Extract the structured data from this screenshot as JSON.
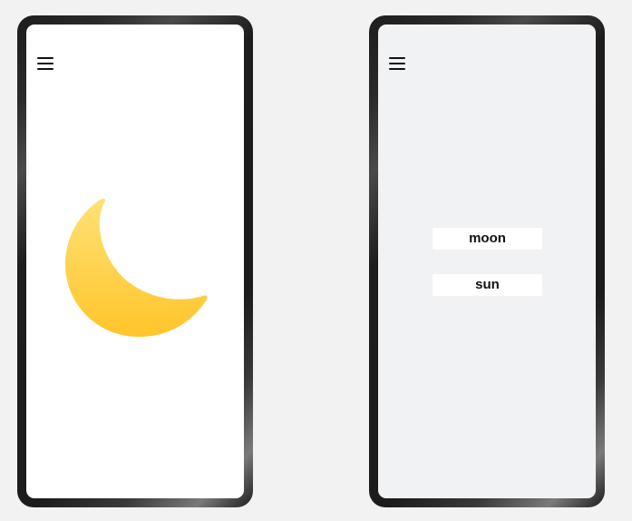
{
  "left_phone": {
    "menu_icon": "hamburger-icon",
    "content_icon": "crescent-moon-icon",
    "moon_colors": {
      "top": "#FFE176",
      "bottom": "#FFC52A"
    },
    "screen_background": "#ffffff"
  },
  "right_phone": {
    "menu_icon": "hamburger-icon",
    "screen_background": "#f1f2f4",
    "options": [
      {
        "label": "moon"
      },
      {
        "label": "sun"
      }
    ]
  }
}
